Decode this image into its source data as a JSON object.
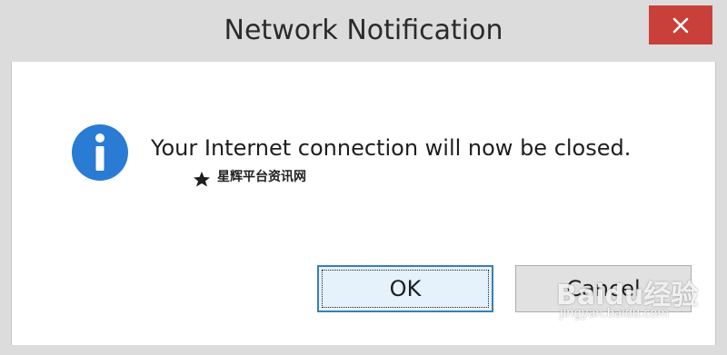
{
  "window": {
    "title": "Network Notification",
    "close_icon": "close-icon"
  },
  "message": {
    "icon": "info-icon",
    "text": "Your Internet connection will now be closed."
  },
  "buttons": {
    "ok_label": "OK",
    "cancel_label": "Cancel"
  },
  "watermarks": {
    "site_text": "星辉平台资讯网",
    "baidu_brand": "Baidu经验",
    "baidu_url": "jingyan.baidu.com"
  },
  "colors": {
    "close_button": "#c9403a",
    "info_icon": "#2a7bd4",
    "ok_border": "#3c7fb1"
  }
}
